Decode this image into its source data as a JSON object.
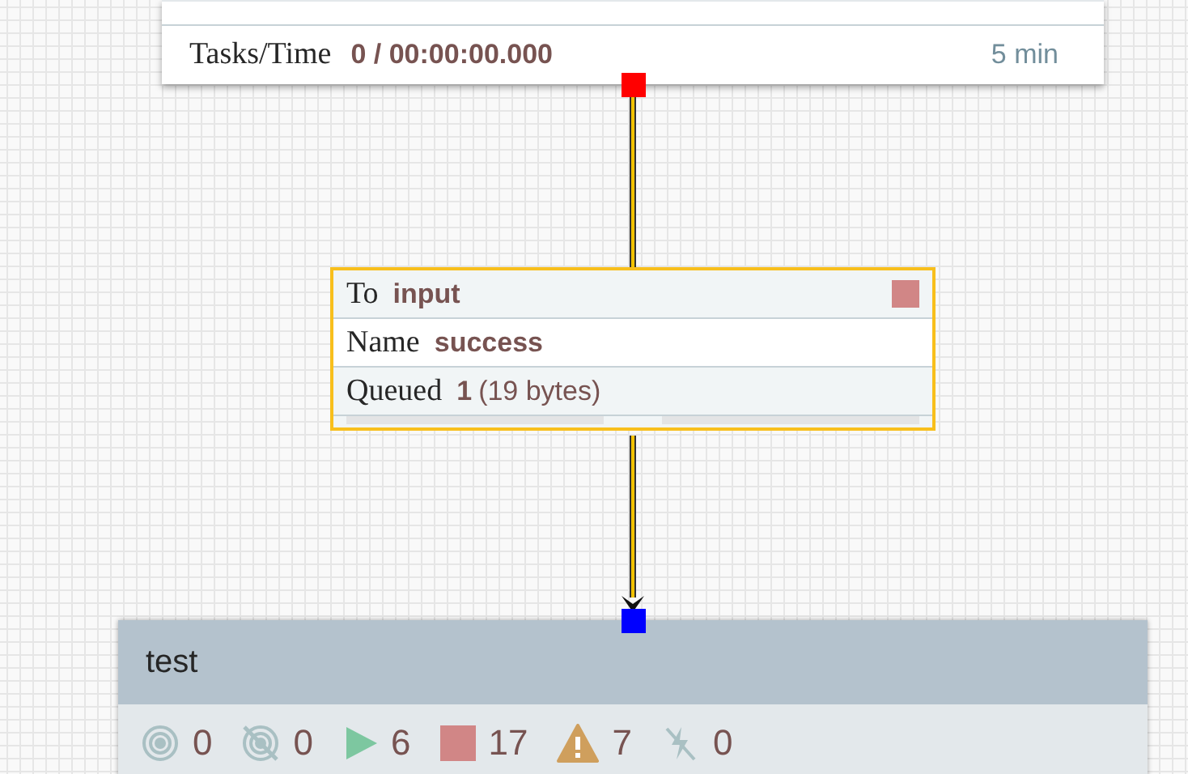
{
  "processor": {
    "tasks_label": "Tasks/Time",
    "tasks_value": "0 / 00:00:00.000",
    "window": "5 min"
  },
  "connection": {
    "to_label": "To",
    "to_value": "input",
    "name_label": "Name",
    "name_value": "success",
    "queued_label": "Queued",
    "queued_count": "1",
    "queued_size": "(19 bytes)",
    "backpressure": [
      {
        "level": 0
      },
      {
        "level": 0
      }
    ]
  },
  "group": {
    "name": "test",
    "stats": [
      {
        "kind": "transmitting",
        "count": "0"
      },
      {
        "kind": "not-transmitting",
        "count": "0"
      },
      {
        "kind": "running",
        "count": "6"
      },
      {
        "kind": "stopped",
        "count": "17"
      },
      {
        "kind": "invalid",
        "count": "7"
      },
      {
        "kind": "disabled",
        "count": "0"
      }
    ]
  }
}
